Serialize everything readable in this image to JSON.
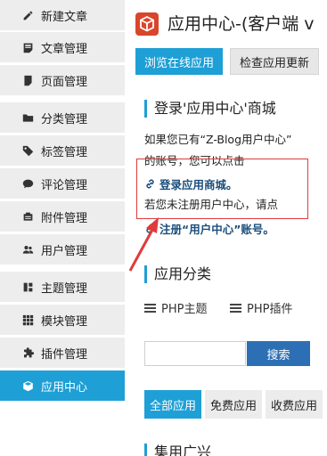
{
  "sidebar": {
    "items": [
      {
        "label": "新建文章",
        "icon": "edit-icon",
        "active": false
      },
      {
        "label": "文章管理",
        "icon": "document-icon",
        "active": false
      },
      {
        "label": "页面管理",
        "icon": "page-icon",
        "active": false
      },
      {
        "label": "分类管理",
        "icon": "folder-icon",
        "active": false
      },
      {
        "label": "标签管理",
        "icon": "tag-icon",
        "active": false
      },
      {
        "label": "评论管理",
        "icon": "comment-icon",
        "active": false
      },
      {
        "label": "附件管理",
        "icon": "attachment-icon",
        "active": false
      },
      {
        "label": "用户管理",
        "icon": "users-icon",
        "active": false
      },
      {
        "label": "主题管理",
        "icon": "theme-icon",
        "active": false
      },
      {
        "label": "模块管理",
        "icon": "modules-icon",
        "active": false
      },
      {
        "label": "插件管理",
        "icon": "puzzle-icon",
        "active": false
      },
      {
        "label": "应用中心",
        "icon": "cube-icon",
        "active": true
      }
    ]
  },
  "header": {
    "title": "应用中心-(客户端 v",
    "logo_icon": "app-center-logo-icon"
  },
  "toolbar": {
    "browse_label": "浏览在线应用",
    "update_label": "检查应用更新"
  },
  "login_section": {
    "title": "登录'应用中心'商城",
    "line1": "如果您已有“Z-Blog用户中心”",
    "line2": "的账号，您可以点击",
    "login_link": "登录应用商城。",
    "line3": "若您未注册用户中心，请点",
    "register_link": "注册“用户中心”账号。"
  },
  "category_section": {
    "title": "应用分类",
    "categories": [
      "PHP主题",
      "PHP插件"
    ]
  },
  "search": {
    "placeholder": "",
    "button_label": "搜索"
  },
  "filters": [
    "全部应用",
    "免费应用",
    "收费应用"
  ],
  "next_section": {
    "title": "集用广兴"
  },
  "colors": {
    "accent": "#1e9fd6",
    "search_button": "#2d6fb5",
    "link": "#1b4e7c",
    "annotation": "#e03b3b",
    "logo": "#d9462b"
  }
}
